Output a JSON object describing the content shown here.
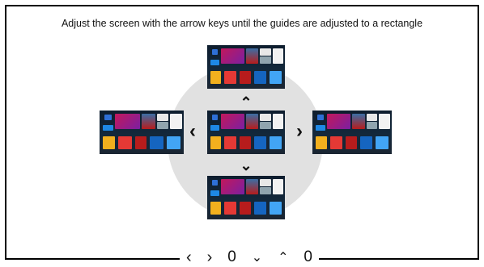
{
  "instruction": "Adjust the screen with the arrow keys until the guides are adjusted to a rectangle",
  "arrows": {
    "up": "⌃",
    "down": "⌄",
    "left": "‹",
    "right": "›"
  },
  "readout": {
    "left": "‹",
    "right": "›",
    "horizontal_value": "0",
    "down": "⌄",
    "up": "⌃",
    "vertical_value": "0"
  },
  "colors": {
    "frame": "#000000",
    "circle": "#e1e1e1",
    "background": "#ffffff"
  },
  "thumbnails": [
    "top",
    "left",
    "center",
    "right",
    "bottom"
  ]
}
